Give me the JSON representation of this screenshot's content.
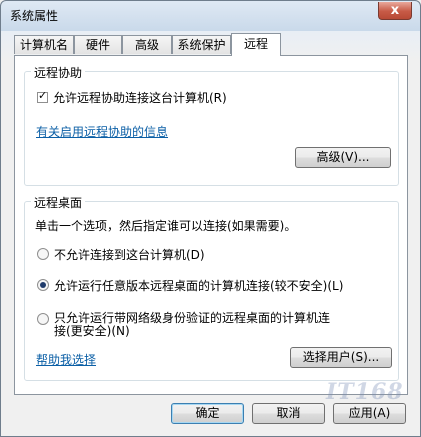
{
  "window": {
    "title": "系统属性",
    "close_label": "x"
  },
  "tabs": [
    {
      "label": "计算机名"
    },
    {
      "label": "硬件"
    },
    {
      "label": "高级"
    },
    {
      "label": "系统保护"
    },
    {
      "label": "远程",
      "active": true
    }
  ],
  "remote_assistance": {
    "title": "远程协助",
    "allow_checkbox": {
      "label": "允许远程协助连接这台计算机(R)",
      "checked": true
    },
    "info_link": "有关启用远程协助的信息",
    "advanced_button": "高级(V)..."
  },
  "remote_desktop": {
    "title": "远程桌面",
    "instructions": "单击一个选项，然后指定谁可以连接(如果需要)。",
    "options": [
      {
        "label": "不允许连接到这台计算机(D)",
        "selected": false
      },
      {
        "label": "允许运行任意版本远程桌面的计算机连接(较不安全)(L)",
        "selected": true
      },
      {
        "label_line1": "只允许运行带网络级身份验证的远程桌面的计算机连",
        "label_line2": "接(更安全)(N)",
        "selected": false
      }
    ],
    "help_link": "帮助我选择",
    "select_users_button": "选择用户(S)..."
  },
  "footer": {
    "ok": "确定",
    "cancel": "取消",
    "apply": "应用(A)"
  },
  "watermark": "IT168"
}
